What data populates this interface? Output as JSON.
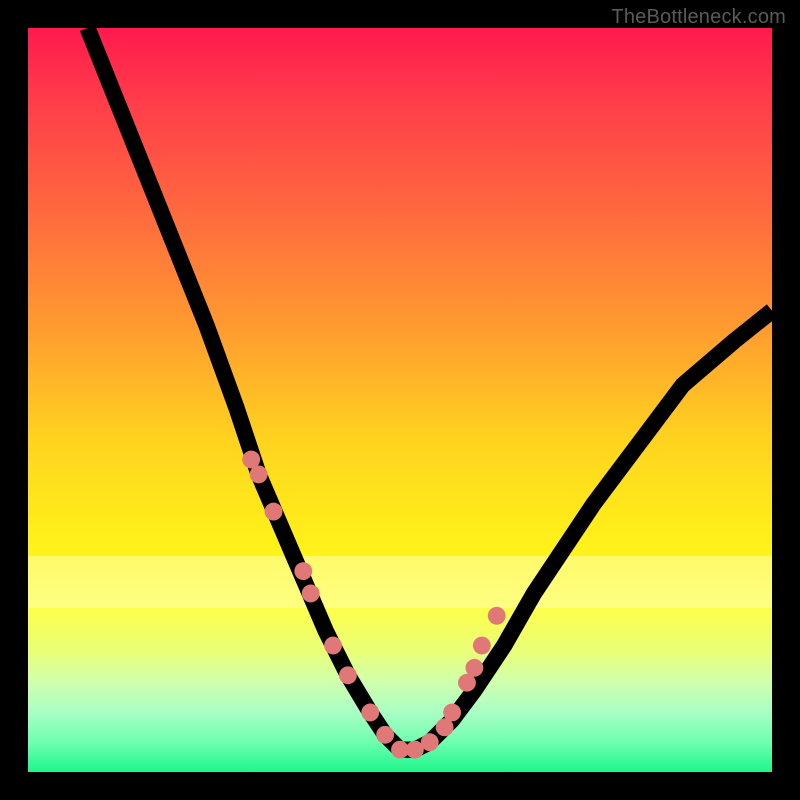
{
  "watermark": "TheBottleneck.com",
  "chart_data": {
    "type": "line",
    "title": "",
    "xlabel": "",
    "ylabel": "",
    "xlim": [
      0,
      100
    ],
    "ylim": [
      0,
      100
    ],
    "grid": false,
    "legend": false,
    "series": [
      {
        "name": "bottleneck-curve",
        "x": [
          8,
          12,
          16,
          20,
          24,
          28,
          31,
          34,
          37,
          40,
          43,
          46,
          48,
          50,
          52,
          54,
          57,
          60,
          64,
          68,
          72,
          76,
          82,
          88,
          95,
          100
        ],
        "y": [
          100,
          90,
          80,
          70,
          60,
          49,
          40,
          33,
          26,
          19,
          13,
          8,
          5,
          3,
          3,
          4,
          7,
          11,
          17,
          24,
          30,
          36,
          44,
          52,
          58,
          62
        ]
      }
    ],
    "markers": {
      "name": "highlight-dots",
      "x": [
        30,
        31,
        33,
        37,
        38,
        41,
        43,
        46,
        48,
        50,
        52,
        54,
        56,
        57,
        59,
        60,
        61,
        63
      ],
      "y": [
        42,
        40,
        35,
        27,
        24,
        17,
        13,
        8,
        5,
        3,
        3,
        4,
        6,
        8,
        12,
        14,
        17,
        21
      ]
    },
    "gradient_stops": [
      {
        "pos": 0,
        "color": "#ff1a4d"
      },
      {
        "pos": 25,
        "color": "#ff6a3e"
      },
      {
        "pos": 55,
        "color": "#ffd21f"
      },
      {
        "pos": 78,
        "color": "#fdff4a"
      },
      {
        "pos": 100,
        "color": "#1ef58d"
      }
    ]
  }
}
